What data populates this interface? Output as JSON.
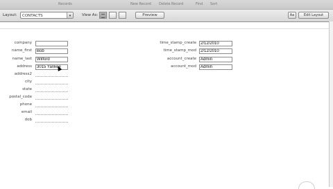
{
  "toolbar": {
    "records_label": "Records",
    "new_record_label": "New Record",
    "delete_record_label": "Delete Record",
    "find_label": "Find",
    "sort_label": "Sort"
  },
  "layout_bar": {
    "layout_label": "Layout:",
    "layout_value": "CONTACTS",
    "view_as_label": "View As:",
    "preview_label": "Preview",
    "aa_label": "Aa",
    "edit_layout_label": "Edit Layout"
  },
  "form": {
    "left_fields": [
      {
        "label": "company",
        "value": ""
      },
      {
        "label": "name_first",
        "value": "Bob"
      },
      {
        "label": "name_last",
        "value": "Wilford"
      },
      {
        "label": "address",
        "value": "3015 Yankee"
      },
      {
        "label": "address2",
        "value": ""
      },
      {
        "label": "city",
        "value": ""
      },
      {
        "label": "state",
        "value": ""
      },
      {
        "label": "postal_code",
        "value": ""
      },
      {
        "label": "phone",
        "value": ""
      },
      {
        "label": "email",
        "value": ""
      },
      {
        "label": "dob",
        "value": ""
      }
    ],
    "right_fields": [
      {
        "label": "time_stamp_create",
        "value": "2/12/2010"
      },
      {
        "label": "time_stamp_mod",
        "value": "2/12/2010"
      },
      {
        "label": "account_create",
        "value": "Admin"
      },
      {
        "label": "account_mod",
        "value": "Admin"
      }
    ]
  }
}
